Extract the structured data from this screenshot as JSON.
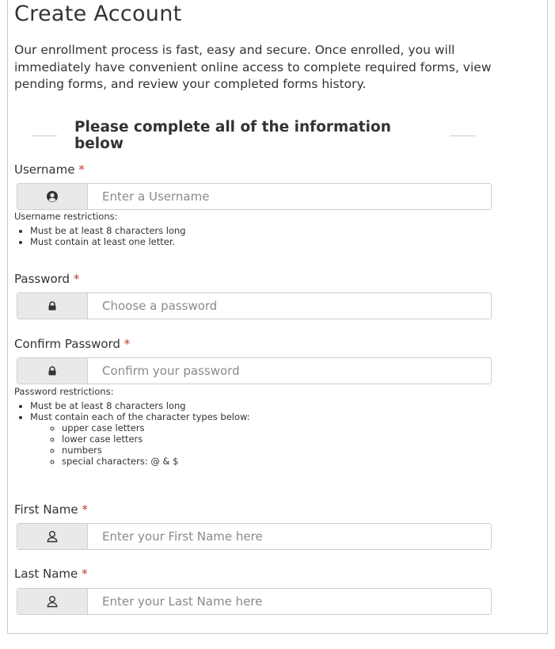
{
  "page": {
    "title": "Create Account",
    "intro": "Our enrollment process is fast, easy and secure. Once enrolled, you will immediately have convenient online access to complete required forms, view pending forms, and review your completed forms history.",
    "section_heading": "Please complete all of the information below",
    "required_marker": "*"
  },
  "fields": {
    "username": {
      "label": "Username",
      "placeholder": "Enter a Username",
      "icon": "user-circle-icon"
    },
    "password": {
      "label": "Password",
      "placeholder": "Choose a password",
      "icon": "lock-icon"
    },
    "confirm_password": {
      "label": "Confirm Password",
      "placeholder": "Confirm your password",
      "icon": "lock-icon"
    },
    "first_name": {
      "label": "First Name",
      "placeholder": "Enter your First Name here",
      "icon": "user-icon"
    },
    "last_name": {
      "label": "Last Name",
      "placeholder": "Enter your Last Name here",
      "icon": "user-icon"
    }
  },
  "username_restrictions": {
    "title": "Username restrictions:",
    "items": [
      "Must be at least 8 characters long",
      "Must contain at least one letter."
    ]
  },
  "password_restrictions": {
    "title": "Password restrictions:",
    "items": [
      "Must be at least 8 characters long",
      "Must contain each of the character types below:"
    ],
    "sub_items": [
      "upper case letters",
      "lower case letters",
      "numbers",
      "special characters: @ & $"
    ]
  },
  "colors": {
    "required": "#c0392b",
    "addon_bg": "#e9e9e9",
    "border": "#cfcfcf"
  }
}
